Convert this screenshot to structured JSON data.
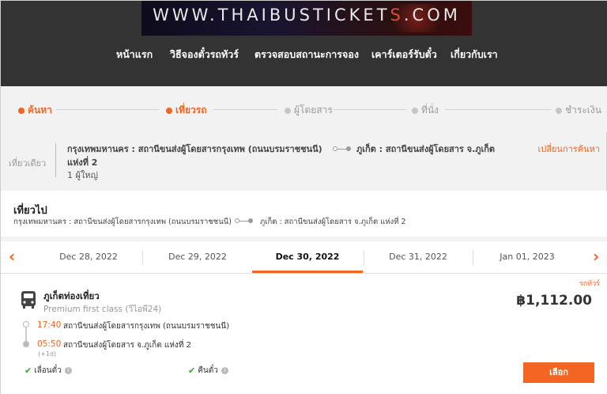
{
  "logo": {
    "prefix": "WWW.THAIBUSTICKET",
    "accent": "S",
    "suffix": ".COM"
  },
  "nav": [
    "หน้าแรก",
    "วิธีจองตั๋วรถทัวร์",
    "ตรวจสอบสถานะการจอง",
    "เคาร์เตอร์รับตั๋ว",
    "เกี่ยวกับเรา"
  ],
  "steps": [
    {
      "label": "ค้นหา",
      "state": "active"
    },
    {
      "label": "เที่ยวรถ",
      "state": "active"
    },
    {
      "label": "ผู้โดยสาร",
      "state": "inactive"
    },
    {
      "label": "ที่นั่ง",
      "state": "inactive"
    },
    {
      "label": "ชำระเงิน",
      "state": "inactive"
    }
  ],
  "summary": {
    "trip_type": "เที่ยวเดียว",
    "from_line1": "กรุงเทพมหานคร : สถานีขนส่งผู้โดยสารกรุงเทพ (ถนนบรมราชชนนี)",
    "from_line2": "แห่งที่ 2",
    "to": "ภูเก็ต : สถานีขนส่งผู้โดยสาร จ.ภูเก็ต",
    "passengers": "1 ผู้ใหญ่",
    "change_search": "เปลี่ยนการค้นหา"
  },
  "section": {
    "title": "เที่ยวไป",
    "from": "กรุงเทพมหานคร : สถานีขนส่งผู้โดยสารกรุงเทพ (ถนนบรมราชชนนี)",
    "to": "ภูเก็ต : สถานีขนส่งผู้โดยสาร จ.ภูเก็ต แห่งที่ 2"
  },
  "dates": [
    "Dec 28, 2022",
    "Dec 29, 2022",
    "Dec 30, 2022",
    "Dec 31, 2022",
    "Jan 01, 2023"
  ],
  "selected_date_index": 2,
  "result": {
    "tag": "รถทัวร์",
    "company": "ภูเก็ตท่องเที่ยว",
    "class": "Premium first class (วีไอพี24)",
    "price": "฿1,112.00",
    "depart_time": "17:40",
    "depart_stop": "สถานีขนส่งผู้โดยสารกรุงเทพ (ถนนบรมราชชนนี)",
    "arrive_time": "05:50",
    "arrive_stop": "สถานีขนส่งผู้โดยสาร จ.ภูเก็ต แห่งที่ 2",
    "next_day": "(+1d)",
    "feature1": "เลื่อนตั๋ว",
    "feature2": "คืนตั๋ว",
    "select_label": "เลือก"
  },
  "colors": {
    "accent": "#f26522",
    "header": "#333333",
    "check": "#3aa335"
  }
}
